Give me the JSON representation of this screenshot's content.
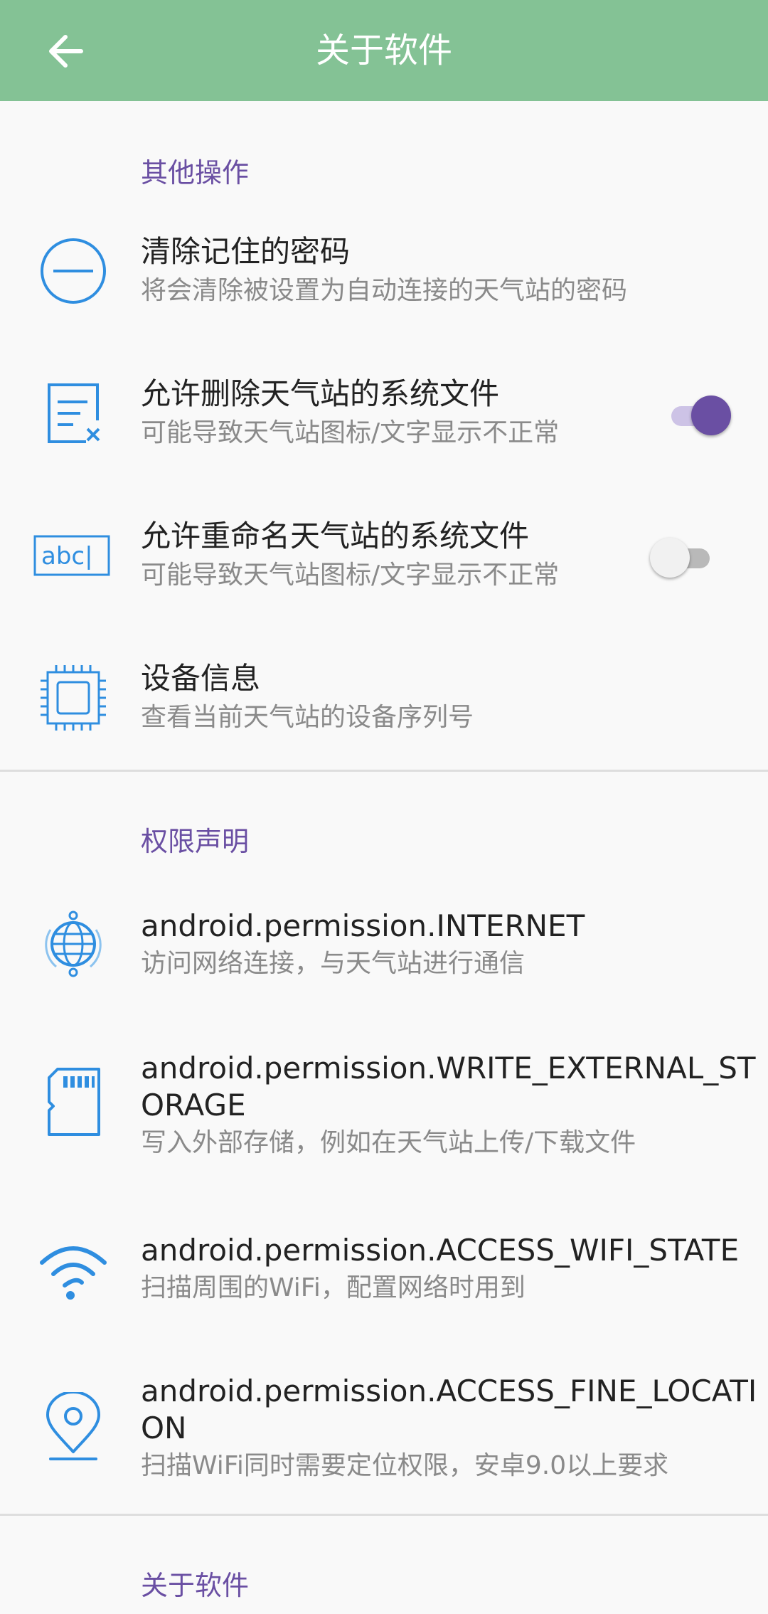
{
  "appbar": {
    "title": "关于软件",
    "back_icon": "arrow-back-icon"
  },
  "sections": {
    "other": {
      "title": "其他操作"
    },
    "permissions": {
      "title": "权限声明"
    },
    "about": {
      "title": "关于软件"
    }
  },
  "other_items": {
    "clear_password": {
      "title": "清除记住的密码",
      "subtitle": "将会清除被设置为自动连接的天气站的密码",
      "icon": "minus-circle-icon"
    },
    "allow_delete": {
      "title": "允许删除天气站的系统文件",
      "subtitle": "可能导致天气站图标/文字显示不正常",
      "icon": "file-delete-icon",
      "enabled": true
    },
    "allow_rename": {
      "title": "允许重命名天气站的系统文件",
      "subtitle": "可能导致天气站图标/文字显示不正常",
      "icon": "rename-abc-icon",
      "enabled": false
    },
    "device_info": {
      "title": "设备信息",
      "subtitle": "查看当前天气站的设备序列号",
      "icon": "chip-icon"
    }
  },
  "permission_items": {
    "internet": {
      "title": "android.permission.INTERNET",
      "subtitle": "访问网络连接，与天气站进行通信",
      "icon": "globe-icon"
    },
    "storage": {
      "title_line1": "android.permission.WRITE_EXTERNAL_ST",
      "title_line2": "ORAGE",
      "subtitle": "写入外部存储，例如在天气站上传/下载文件",
      "icon": "sd-card-icon"
    },
    "wifi": {
      "title": "android.permission.ACCESS_WIFI_STATE",
      "subtitle": "扫描周围的WiFi，配置网络时用到",
      "icon": "wifi-icon"
    },
    "location": {
      "title_line1": "android.permission.ACCESS_FINE_LOCATI",
      "title_line2": "ON",
      "subtitle": "扫描WiFi同时需要定位权限，安卓9.0以上要求",
      "icon": "location-pin-icon"
    }
  },
  "abc_icon_text": "abc|",
  "colors": {
    "appbar": "#84c295",
    "accent": "#6a4fa3",
    "icon_blue": "#2f8ee0"
  }
}
